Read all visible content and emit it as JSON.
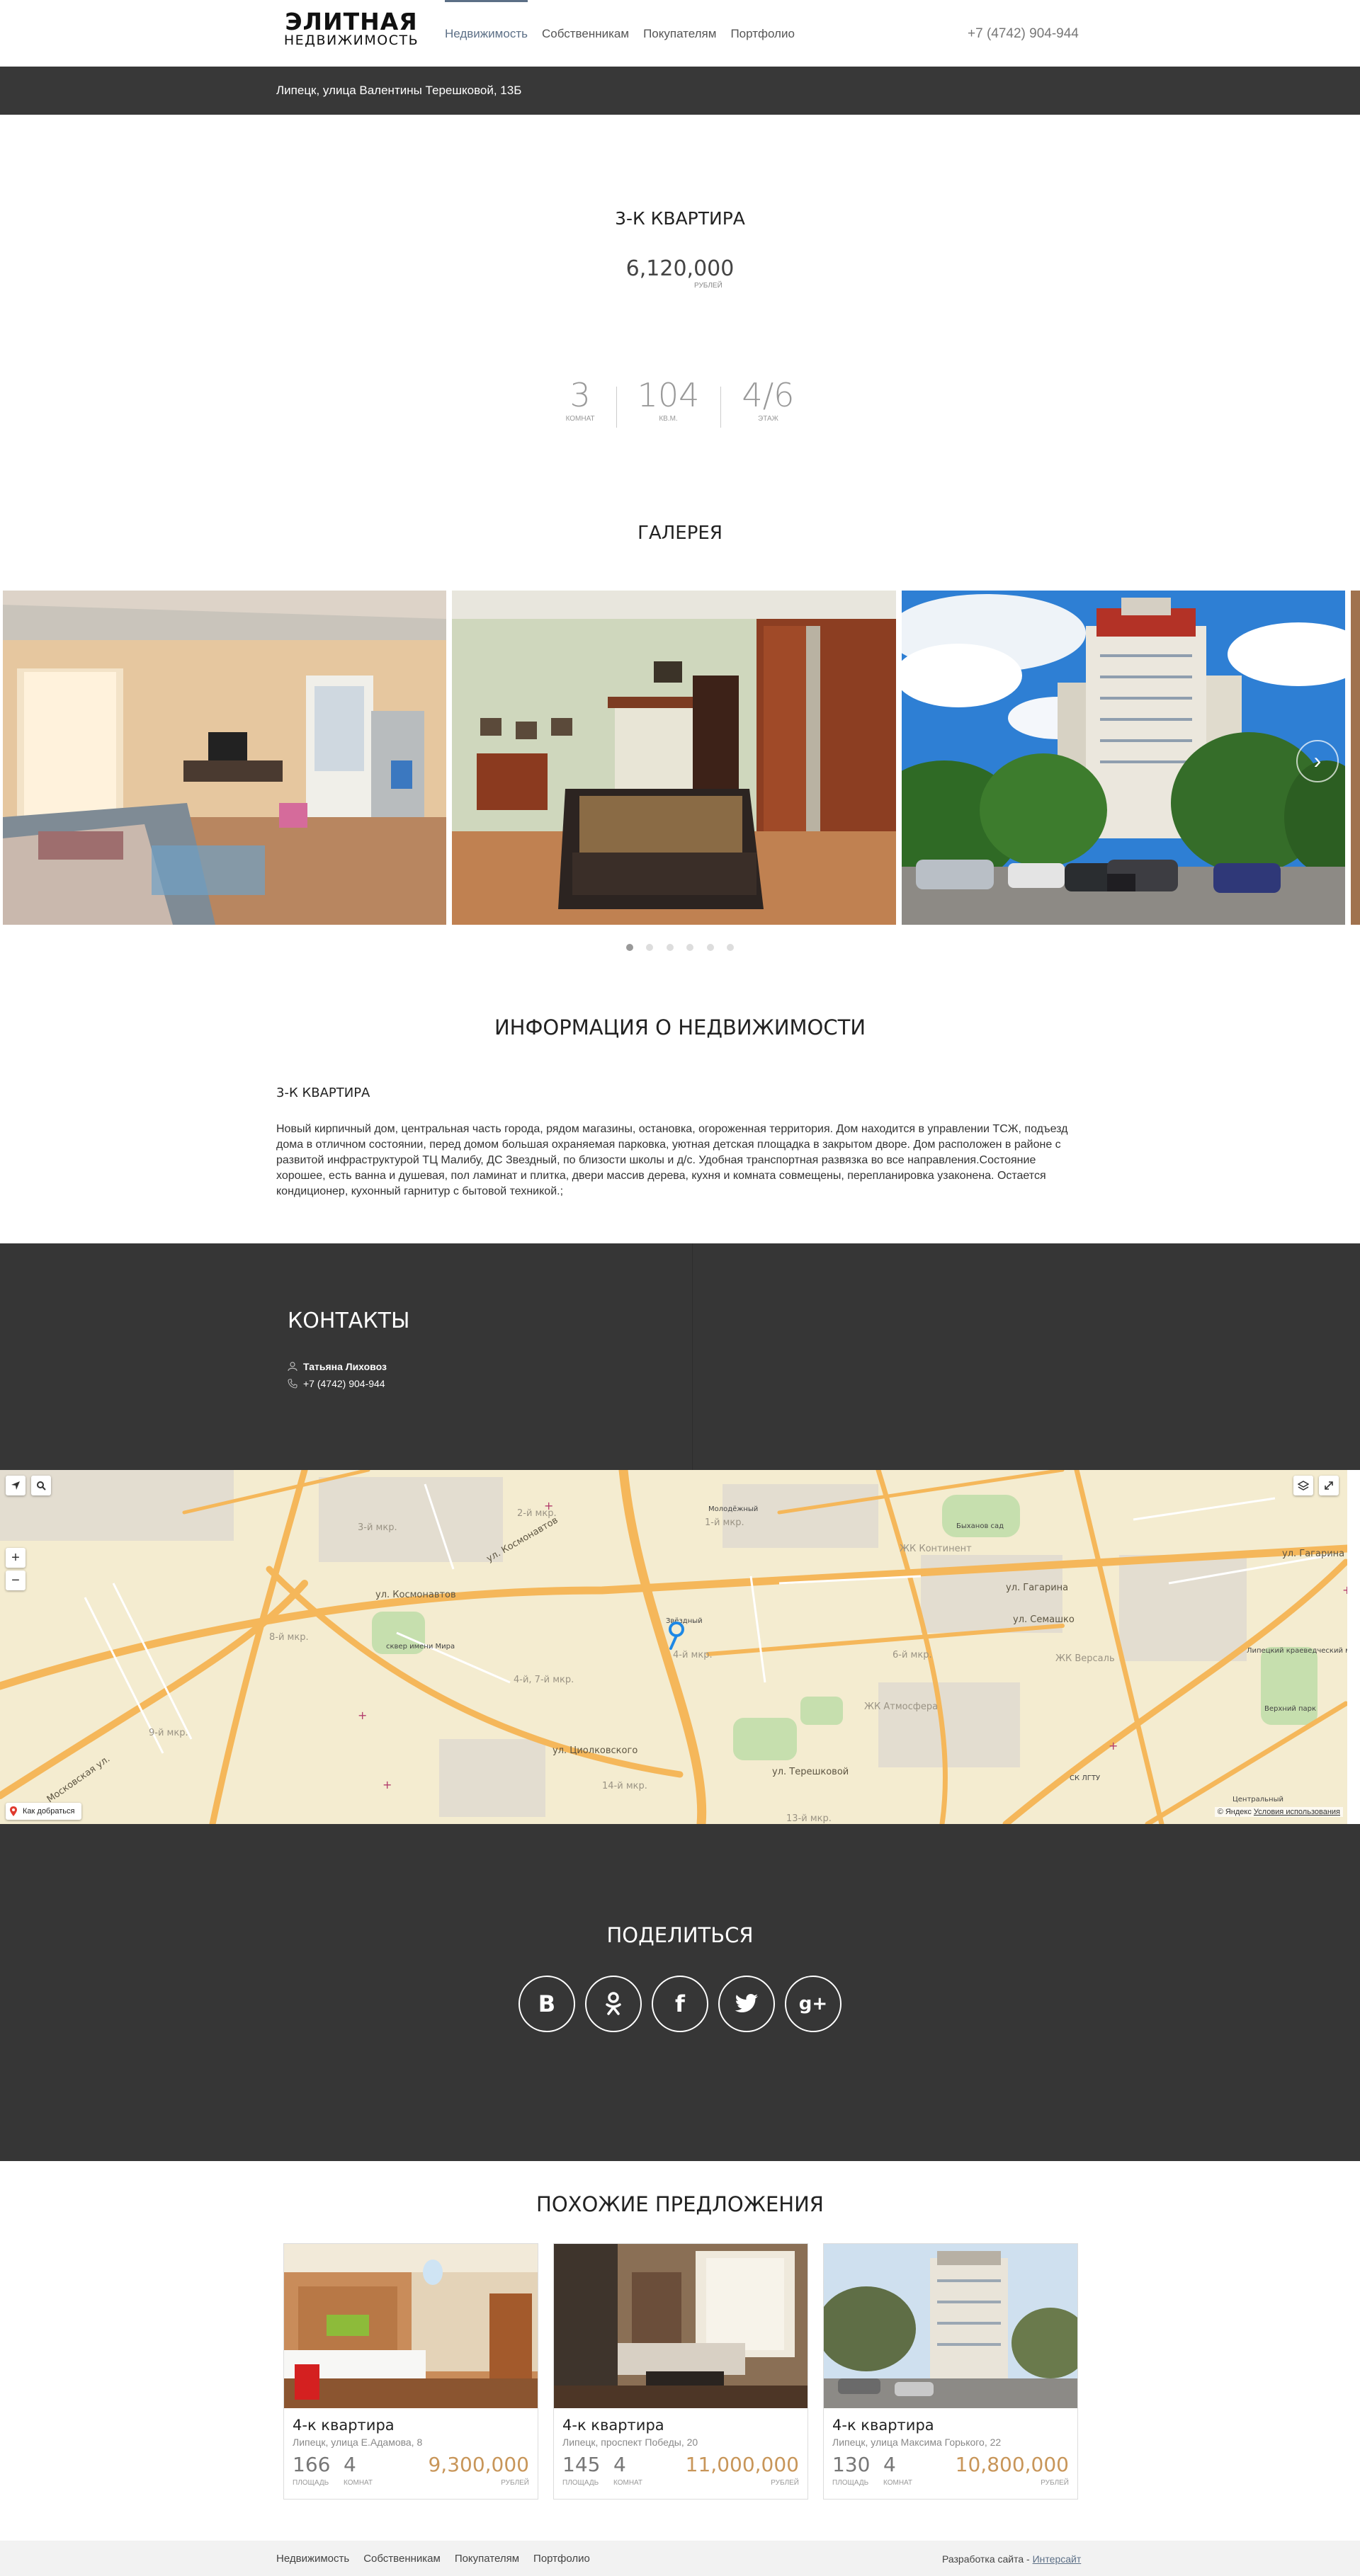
{
  "header": {
    "logo_line1": "ЭЛИТНАЯ",
    "logo_line2": "НЕДВИЖИМОСТЬ",
    "nav": [
      {
        "label": "Недвижимость",
        "active": true
      },
      {
        "label": "Собственникам"
      },
      {
        "label": "Покупателям"
      },
      {
        "label": "Портфолио"
      }
    ],
    "phone": "+7 (4742) 904-944"
  },
  "address_bar": {
    "text": "Липецк, улица Валентины Терешковой, 13Б"
  },
  "property": {
    "title": "3-К КВАРТИРА",
    "price": "6,120,000",
    "price_unit": "рублей",
    "stats": [
      {
        "value": "3",
        "label": "комнат"
      },
      {
        "value": "104",
        "label": "кв.м."
      },
      {
        "value": "4/6",
        "label": "этаж"
      }
    ]
  },
  "gallery": {
    "title": "ГАЛЕРЕЯ",
    "slide_count": 6,
    "active_slide": 1,
    "next_icon": "chevron-right-icon"
  },
  "info": {
    "title": "ИНФОРМАЦИЯ О НЕДВИЖИМОСТИ",
    "subtitle": "3-К КВАРТИРА",
    "description": "Новый кирпичный дом, центральная часть города, рядом магазины, остановка, огороженная территория. Дом находится в управлении ТСЖ, подъезд дома в отличном состоянии, перед домом большая охраняемая парковка, уютная детская площадка в закрытом дворе. Дом расположен в районе с развитой инфраструктурой ТЦ Малибу, ДС Звездный, по близости школы и д/с. Удобная транспортная развязка во все направления.Состояние хорошее, есть ванна и душевая, пол ламинат и плитка, двери массив дерева, кухня и комната совмещены, перепланировка узаконена. Остается кондиционер, кухонный гарнитур с бытовой техникой.;"
  },
  "contacts": {
    "title": "КОНТАКТЫ",
    "name": "Татьяна Лиховоз",
    "phone": "+7 (4742) 904-944"
  },
  "map": {
    "route_label": "Как добраться",
    "copyright": "© Яндекс",
    "terms": "Условия использования",
    "labels": {
      "street_gagarina_right": "ул. Гагарина",
      "street_gagarina_top": "ул. Гагарина",
      "street_kosmonavtov": "ул. Космонавтов",
      "street_kosmonavtov2": "ул. Космонавтов",
      "street_tsiolkovskogo": "ул. Циолковского",
      "street_moskovskaya": "Московская ул.",
      "street_semashko": "ул. Семашко",
      "street_terekhova": "ул. Терешковой",
      "district_3": "3-й мкр.",
      "district_2": "2-й мкр.",
      "district_1": "1-й мкр.",
      "district_8": "8-й мкр.",
      "district_4": "4-й мкр.",
      "district_47": "4-й, 7-й мкр.",
      "district_6": "6-й мкр.",
      "district_9": "9-й мкр.",
      "district_14": "14-й мкр.",
      "district_13": "13-й мкр.",
      "zhk_kontinent": "ЖК Континент",
      "zhk_versal": "ЖК Версаль",
      "zhk_atmosfera": "ЖК Атмосфера",
      "molodezhny": "Молодёжный",
      "zvezdny": "Звёздный",
      "bykhanov": "Быханов сад",
      "park_mira": "сквер имени Мира",
      "lipetsk_museum": "Липецкий краеведческий музей",
      "verkhny_park": "Верхний парк",
      "lgtu": "СК ЛГТУ",
      "tsentralny": "Центральный"
    }
  },
  "share": {
    "title": "ПОДЕЛИТЬСЯ",
    "buttons": [
      {
        "name": "vk-icon",
        "glyph": "В"
      },
      {
        "name": "odnoklassniki-icon",
        "glyph": "ok"
      },
      {
        "name": "facebook-icon",
        "glyph": "f"
      },
      {
        "name": "twitter-icon",
        "glyph": "t"
      },
      {
        "name": "google-plus-icon",
        "glyph": "g+"
      }
    ]
  },
  "similar": {
    "title": "ПОХОЖИЕ ПРЕДЛОЖЕНИЯ",
    "area_label": "площадь",
    "rooms_label": "комнат",
    "unit_label": "рублей",
    "cards": [
      {
        "title": "4-к квартира",
        "address": "Липецк, улица Е.Адамова, 8",
        "area": "166",
        "rooms": "4",
        "price": "9,300,000"
      },
      {
        "title": "4-к квартира",
        "address": "Липецк, проспект Победы, 20",
        "area": "145",
        "rooms": "4",
        "price": "11,000,000"
      },
      {
        "title": "4-к квартира",
        "address": "Липецк, улица Максима Горького, 22",
        "area": "130",
        "rooms": "4",
        "price": "10,800,000"
      }
    ]
  },
  "footer": {
    "nav": [
      "Недвижимость",
      "Собственникам",
      "Покупателям",
      "Портфолио"
    ],
    "dev_prefix": "Разработка сайта -",
    "dev_link": "Интерсайт"
  },
  "colors": {
    "dark": "#363636",
    "accent": "#5c6f86",
    "price": "#c8965a",
    "map_bg": "#f4ecd0",
    "road": "#f5b75a"
  }
}
